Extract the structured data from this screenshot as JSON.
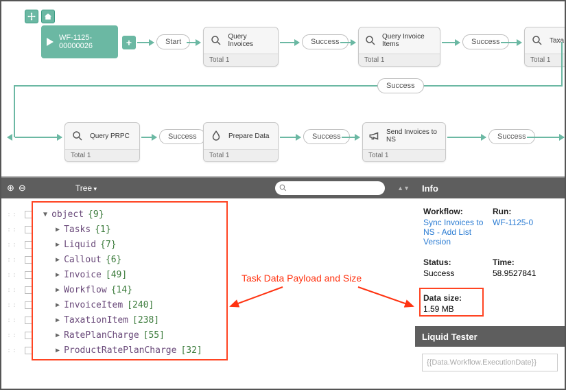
{
  "workflow_id": "WF-1125-00000026",
  "nodes_top": [
    {
      "label": "Start",
      "type": "pill"
    },
    {
      "label": "Query Invoices",
      "total": "Total 1",
      "icon": "search"
    },
    {
      "label": "Success",
      "type": "pill"
    },
    {
      "label": "Query Invoice Items",
      "total": "Total 1",
      "icon": "search"
    },
    {
      "label": "Success",
      "type": "pill"
    },
    {
      "label": "Taxa",
      "total": "Total 1",
      "icon": "search"
    }
  ],
  "nodes_bottom": [
    {
      "label": "Query PRPC",
      "total": "Total 1",
      "icon": "search"
    },
    {
      "label": "Success",
      "type": "pill"
    },
    {
      "label": "Prepare Data",
      "total": "Total 1",
      "icon": "drop"
    },
    {
      "label": "Success",
      "type": "pill"
    },
    {
      "label": "Send Invoices to NS",
      "total": "Total 1",
      "icon": "megaphone"
    },
    {
      "label": "Success",
      "type": "pill"
    }
  ],
  "wrap_pill": "Success",
  "tree_view_label": "Tree",
  "tree": {
    "root_key": "object",
    "root_count": "{9}",
    "children": [
      {
        "key": "Tasks",
        "count": "{1}"
      },
      {
        "key": "Liquid",
        "count": "{7}"
      },
      {
        "key": "Callout",
        "count": "{6}"
      },
      {
        "key": "Invoice",
        "count": "[49]"
      },
      {
        "key": "Workflow",
        "count": "{14}"
      },
      {
        "key": "InvoiceItem",
        "count": "[240]"
      },
      {
        "key": "TaxationItem",
        "count": "[238]"
      },
      {
        "key": "RatePlanCharge",
        "count": "[55]"
      },
      {
        "key": "ProductRatePlanCharge",
        "count": "[32]"
      }
    ]
  },
  "info": {
    "header": "Info",
    "workflow_label": "Workflow:",
    "workflow_link": "Sync Invoices to NS - Add List Version",
    "run_label": "Run:",
    "run_link": "WF-1125-0",
    "status_label": "Status:",
    "status_value": "Success",
    "time_label": "Time:",
    "time_value": "58.9527841",
    "datasize_label": "Data size:",
    "datasize_value": "1.59 MB"
  },
  "liquid": {
    "header": "Liquid Tester",
    "placeholder": "{{Data.Workflow.ExecutionDate}}"
  },
  "annotation": "Task Data Payload and Size"
}
